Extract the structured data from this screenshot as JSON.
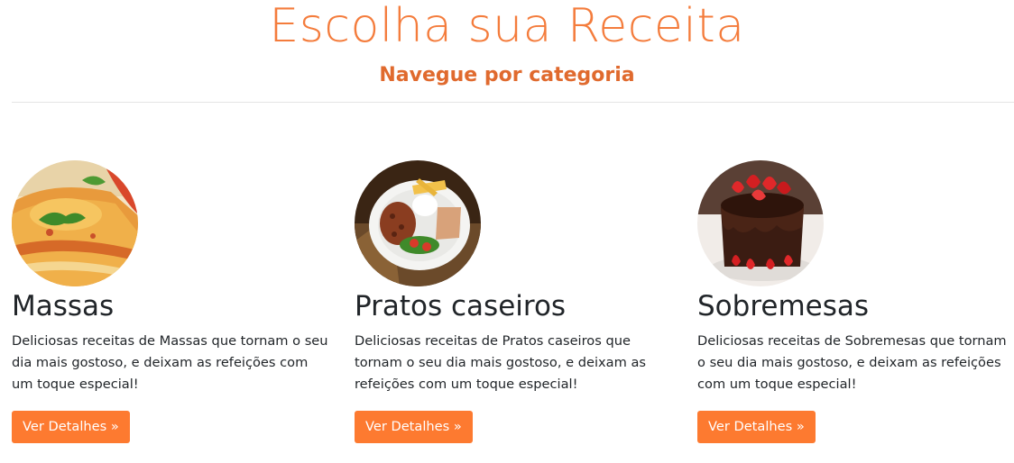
{
  "header": {
    "title": "Escolha sua Receita",
    "subtitle": "Navegue por categoria"
  },
  "colors": {
    "accent": "#f47c3c",
    "subtitle": "#e06a2e",
    "button": "#fd7a30",
    "text": "#212529"
  },
  "categories": [
    {
      "name": "Massas",
      "description": "Deliciosas receitas de Massas que tornam o seu dia mais gostoso, e deixam as refeições com um toque especial!",
      "button_label": "Ver Detalhes »",
      "image": "lasagna-photo"
    },
    {
      "name": "Pratos caseiros",
      "description": "Deliciosas receitas de Pratos caseiros que tornam o seu dia mais gostoso, e deixam as refeições com um toque especial!",
      "button_label": "Ver Detalhes »",
      "image": "home-meal-plate-photo"
    },
    {
      "name": "Sobremesas",
      "description": "Deliciosas receitas de Sobremesas que tornam o seu dia mais gostoso, e deixam as refeições com um toque especial!",
      "button_label": "Ver Detalhes »",
      "image": "strawberry-chocolate-cake-photo"
    }
  ]
}
